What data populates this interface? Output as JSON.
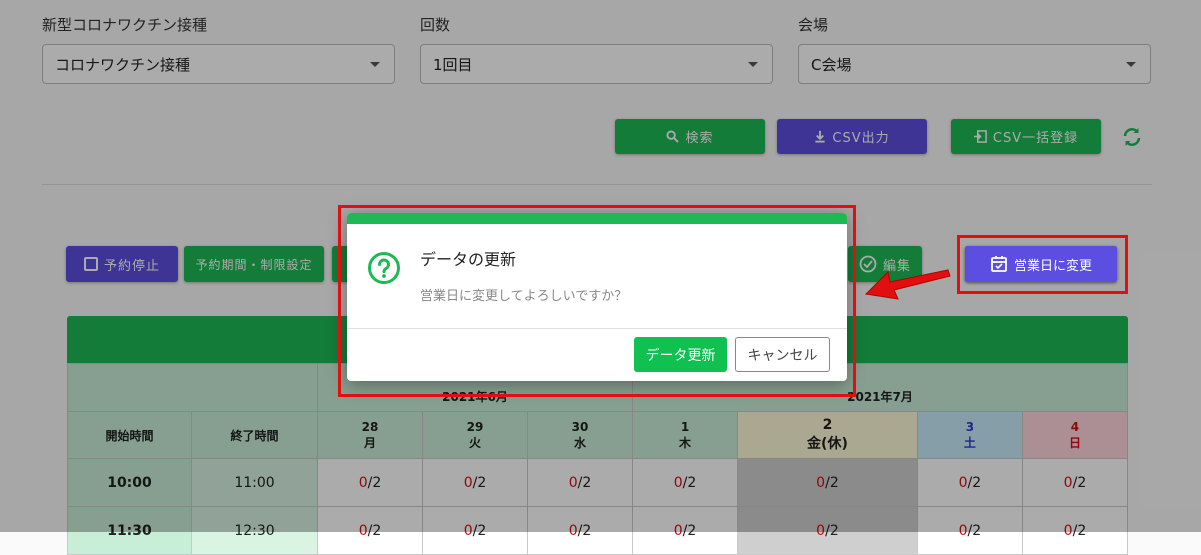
{
  "filters": {
    "vaccine": {
      "label": "新型コロナワクチン接種",
      "value": "コロナワクチン接種"
    },
    "count": {
      "label": "回数",
      "value": "1回目"
    },
    "venue": {
      "label": "会場",
      "value": "C会場"
    }
  },
  "actions": {
    "search": "検索",
    "csv_export": "CSV出力",
    "csv_import": "CSV一括登録"
  },
  "toolbar": {
    "stop": "予約停止",
    "period": "予約期間・制限設定",
    "edit": "編集",
    "business_day": "営業日に変更"
  },
  "calendar": {
    "months": [
      "2021年6月",
      "2021年7月"
    ],
    "start_label": "開始時間",
    "end_label": "終了時間",
    "days": [
      {
        "num": "28",
        "dow": "月"
      },
      {
        "num": "29",
        "dow": "火"
      },
      {
        "num": "30",
        "dow": "水"
      },
      {
        "num": "1",
        "dow": "木"
      },
      {
        "num": "2",
        "dow": "金(休)"
      },
      {
        "num": "3",
        "dow": "土"
      },
      {
        "num": "4",
        "dow": "日"
      }
    ],
    "rows": [
      {
        "start": "10:00",
        "end": "11:00",
        "booked": "0",
        "cap": "2"
      },
      {
        "start": "11:30",
        "end": "12:30",
        "booked": "0",
        "cap": "2"
      }
    ]
  },
  "dialog": {
    "title": "データの更新",
    "message": "営業日に変更してよろしいですか？",
    "confirm": "データ更新",
    "cancel": "キャンセル"
  },
  "colors": {
    "green": "#1eb955",
    "purple": "#5b4ee0",
    "highlight": "#e01010"
  }
}
